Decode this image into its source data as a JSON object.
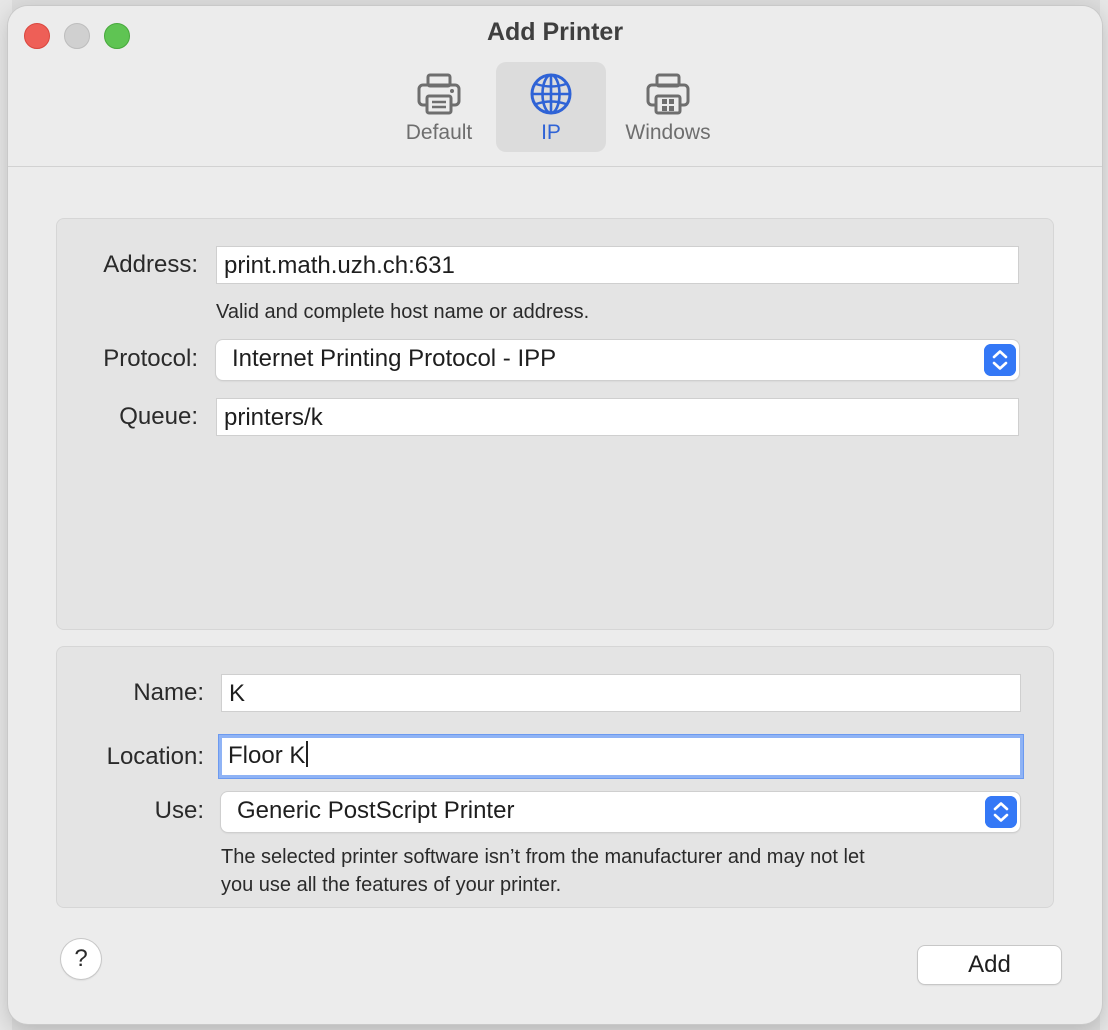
{
  "window": {
    "title": "Add Printer"
  },
  "toolbar": {
    "tabs": [
      {
        "label": "Default",
        "icon": "printer-icon"
      },
      {
        "label": "IP",
        "icon": "globe-icon",
        "selected": true
      },
      {
        "label": "Windows",
        "icon": "windows-printer-icon"
      }
    ]
  },
  "connection": {
    "address_label": "Address:",
    "address_value": "print.math.uzh.ch:631",
    "address_hint": "Valid and complete host name or address.",
    "protocol_label": "Protocol:",
    "protocol_value": "Internet Printing Protocol - IPP",
    "queue_label": "Queue:",
    "queue_value": "printers/k"
  },
  "details": {
    "name_label": "Name:",
    "name_value": "K",
    "location_label": "Location:",
    "location_value": "Floor K",
    "use_label": "Use:",
    "use_value": "Generic PostScript Printer",
    "use_hint_line1": "The selected printer software isn’t from the manufacturer and may not let",
    "use_hint_line2": "you use all the features of your printer."
  },
  "footer": {
    "help_label": "?",
    "add_label": "Add"
  },
  "colors": {
    "accent": "#3478f6",
    "selected_tab_text": "#2f63d6",
    "focus_ring": "#8fb3f5"
  }
}
